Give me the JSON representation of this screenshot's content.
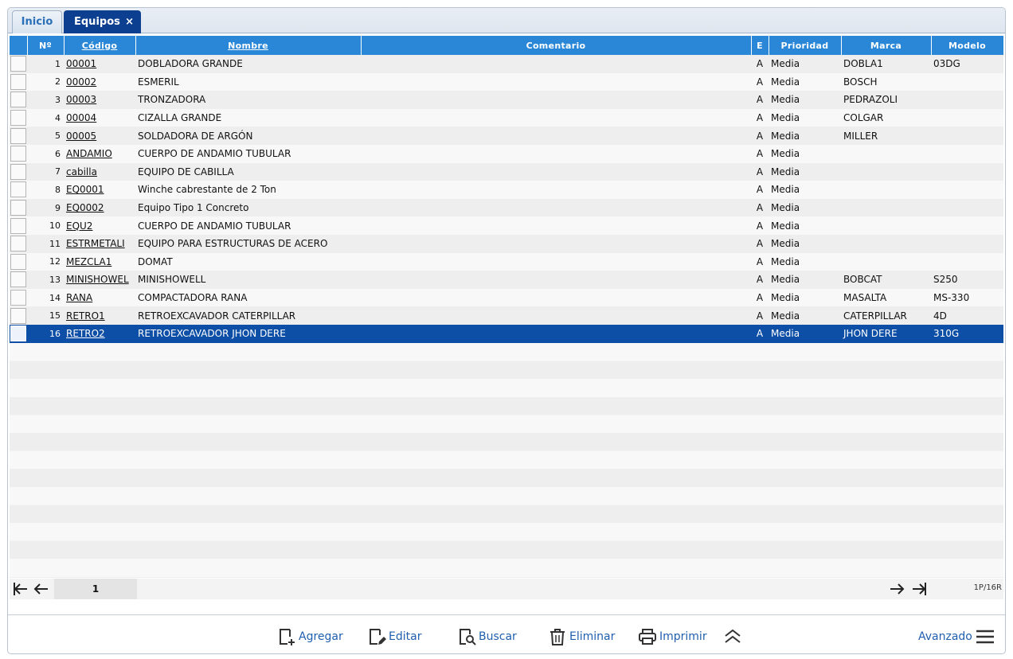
{
  "tabs": [
    {
      "label": "Inicio"
    },
    {
      "label": "Equipos",
      "close": "×"
    }
  ],
  "columns": {
    "num": "Nº",
    "codigo": "Código",
    "nombre": "Nombre",
    "comentario": "Comentario",
    "e": "E",
    "prioridad": "Prioridad",
    "marca": "Marca",
    "modelo": "Modelo"
  },
  "rows": [
    {
      "num": "1",
      "codigo": "00001",
      "nombre": "DOBLADORA GRANDE",
      "comentario": "",
      "e": "A",
      "prioridad": "Media",
      "marca": "DOBLA1",
      "modelo": "03DG"
    },
    {
      "num": "2",
      "codigo": "00002",
      "nombre": "ESMERIL",
      "comentario": "",
      "e": "A",
      "prioridad": "Media",
      "marca": "BOSCH",
      "modelo": ""
    },
    {
      "num": "3",
      "codigo": "00003",
      "nombre": "TRONZADORA",
      "comentario": "",
      "e": "A",
      "prioridad": "Media",
      "marca": "PEDRAZOLI",
      "modelo": ""
    },
    {
      "num": "4",
      "codigo": "00004",
      "nombre": "CIZALLA GRANDE",
      "comentario": "",
      "e": "A",
      "prioridad": "Media",
      "marca": "COLGAR",
      "modelo": ""
    },
    {
      "num": "5",
      "codigo": "00005",
      "nombre": "SOLDADORA DE ARGÓN",
      "comentario": "",
      "e": "A",
      "prioridad": "Media",
      "marca": "MILLER",
      "modelo": ""
    },
    {
      "num": "6",
      "codigo": "ANDAMIO",
      "nombre": "CUERPO DE ANDAMIO TUBULAR",
      "comentario": "",
      "e": "A",
      "prioridad": "Media",
      "marca": "",
      "modelo": ""
    },
    {
      "num": "7",
      "codigo": "cabilla",
      "nombre": "EQUIPO DE CABILLA",
      "comentario": "",
      "e": "A",
      "prioridad": "Media",
      "marca": "",
      "modelo": ""
    },
    {
      "num": "8",
      "codigo": "EQ0001",
      "nombre": "Winche cabrestante de 2 Ton",
      "comentario": "",
      "e": "A",
      "prioridad": "Media",
      "marca": "",
      "modelo": ""
    },
    {
      "num": "9",
      "codigo": "EQ0002",
      "nombre": "Equipo Tipo 1 Concreto",
      "comentario": "",
      "e": "A",
      "prioridad": "Media",
      "marca": "",
      "modelo": ""
    },
    {
      "num": "10",
      "codigo": "EQU2",
      "nombre": "CUERPO DE ANDAMIO TUBULAR",
      "comentario": "",
      "e": "A",
      "prioridad": "Media",
      "marca": "",
      "modelo": ""
    },
    {
      "num": "11",
      "codigo": "ESTRMETALI",
      "nombre": "EQUIPO PARA ESTRUCTURAS DE ACERO",
      "comentario": "",
      "e": "A",
      "prioridad": "Media",
      "marca": "",
      "modelo": ""
    },
    {
      "num": "12",
      "codigo": "MEZCLA1",
      "nombre": "DOMAT",
      "comentario": "",
      "e": "A",
      "prioridad": "Media",
      "marca": "",
      "modelo": ""
    },
    {
      "num": "13",
      "codigo": "MINISHOWEL",
      "nombre": "MINISHOWELL",
      "comentario": "",
      "e": "A",
      "prioridad": "Media",
      "marca": "BOBCAT",
      "modelo": "S250"
    },
    {
      "num": "14",
      "codigo": "RANA",
      "nombre": "COMPACTADORA RANA",
      "comentario": "",
      "e": "A",
      "prioridad": "Media",
      "marca": "MASALTA",
      "modelo": "MS-330"
    },
    {
      "num": "15",
      "codigo": "RETRO1",
      "nombre": "RETROEXCAVADOR CATERPILLAR",
      "comentario": "",
      "e": "A",
      "prioridad": "Media",
      "marca": "CATERPILLAR",
      "modelo": "4D"
    },
    {
      "num": "16",
      "codigo": "RETRO2",
      "nombre": "RETROEXCAVADOR JHON DERE",
      "comentario": "",
      "e": "A",
      "prioridad": "Media",
      "marca": "JHON DERE",
      "modelo": "310G",
      "selected": true
    }
  ],
  "pager": {
    "page": "1",
    "count": "1P/16R",
    "icons": [
      "first-page-icon",
      "prev-page-icon",
      "next-page-icon",
      "last-page-icon"
    ]
  },
  "toolbar": {
    "agregar": "Agregar",
    "editar": "Editar",
    "buscar": "Buscar",
    "eliminar": "Eliminar",
    "imprimir": "Imprimir",
    "avanzado": "Avanzado",
    "icons": [
      "add-doc-icon",
      "edit-doc-icon",
      "search-doc-icon",
      "trash-icon",
      "printer-icon",
      "chevron-double-up-icon",
      "menu-icon"
    ]
  },
  "colors": {
    "header": "#2a87d8",
    "selected_row": "#0d4ea6",
    "active_tab": "#0d3f91",
    "toolbar_text": "#1f5fae"
  }
}
